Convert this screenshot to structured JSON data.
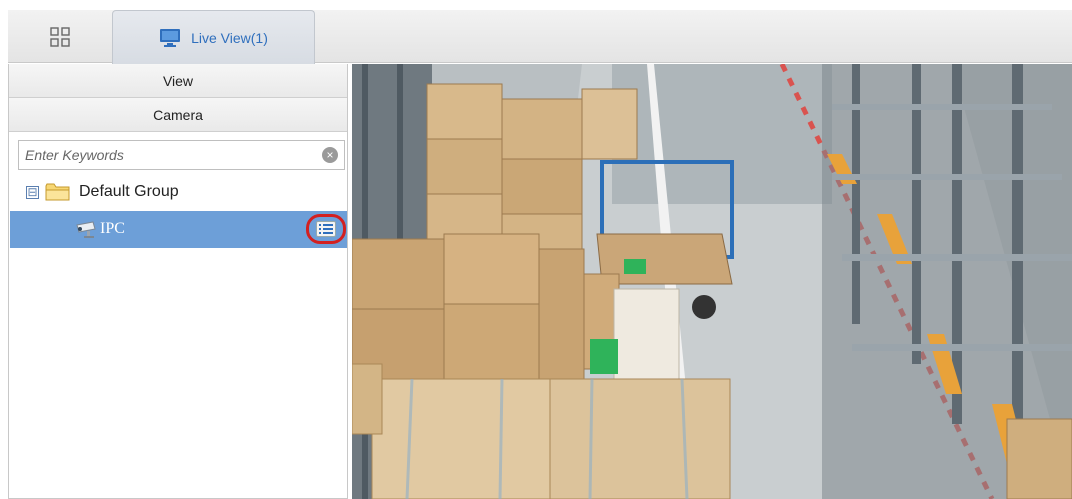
{
  "tabs": {
    "home_icon": "grid-icon",
    "live_view": {
      "label": "Live View(1)",
      "icon": "monitor-icon"
    }
  },
  "left_panel": {
    "view_header": "View",
    "camera_header": "Camera",
    "search": {
      "placeholder": "Enter Keywords",
      "value": ""
    },
    "tree": {
      "group": {
        "label": "Default Group",
        "expander": "⊟"
      },
      "items": [
        {
          "label": "IPC",
          "icon": "camera-icon",
          "selected": true
        }
      ]
    }
  },
  "video": {
    "content": "warehouse-live-feed"
  },
  "colors": {
    "accent": "#2f6fbd",
    "selection": "#6d9fd8",
    "highlight_ring": "#d32020"
  }
}
